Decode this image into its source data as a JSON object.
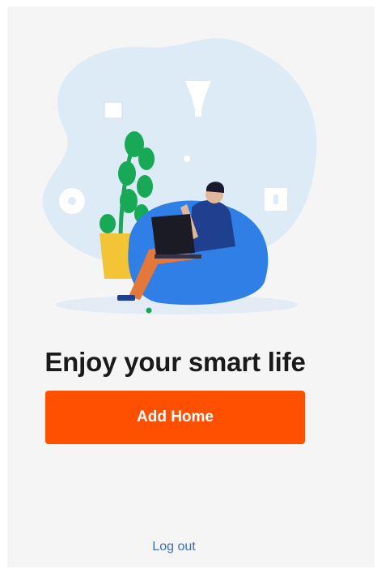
{
  "welcome": {
    "title": "Enjoy your smart life",
    "add_home_label": "Add Home",
    "logout_label": "Log out",
    "page_indicator": {
      "total": 1,
      "active": 1
    }
  },
  "colors": {
    "background": "#f5f5f5",
    "primary_button": "#ff5000",
    "link": "#3b6fb6",
    "accent_green": "#18a957",
    "blob_light_blue": "#dcebf5",
    "beanbag_blue": "#2f7fe6",
    "person_pants": "#e3783a",
    "person_sweater": "#1f3f8f",
    "pot_yellow": "#f2c436"
  },
  "icons": {
    "illustration": "person-on-beanbag-with-laptop",
    "decor": [
      "lightbulb-icon",
      "fan-icon",
      "smart-plug-icon",
      "picture-frame-icon"
    ]
  }
}
